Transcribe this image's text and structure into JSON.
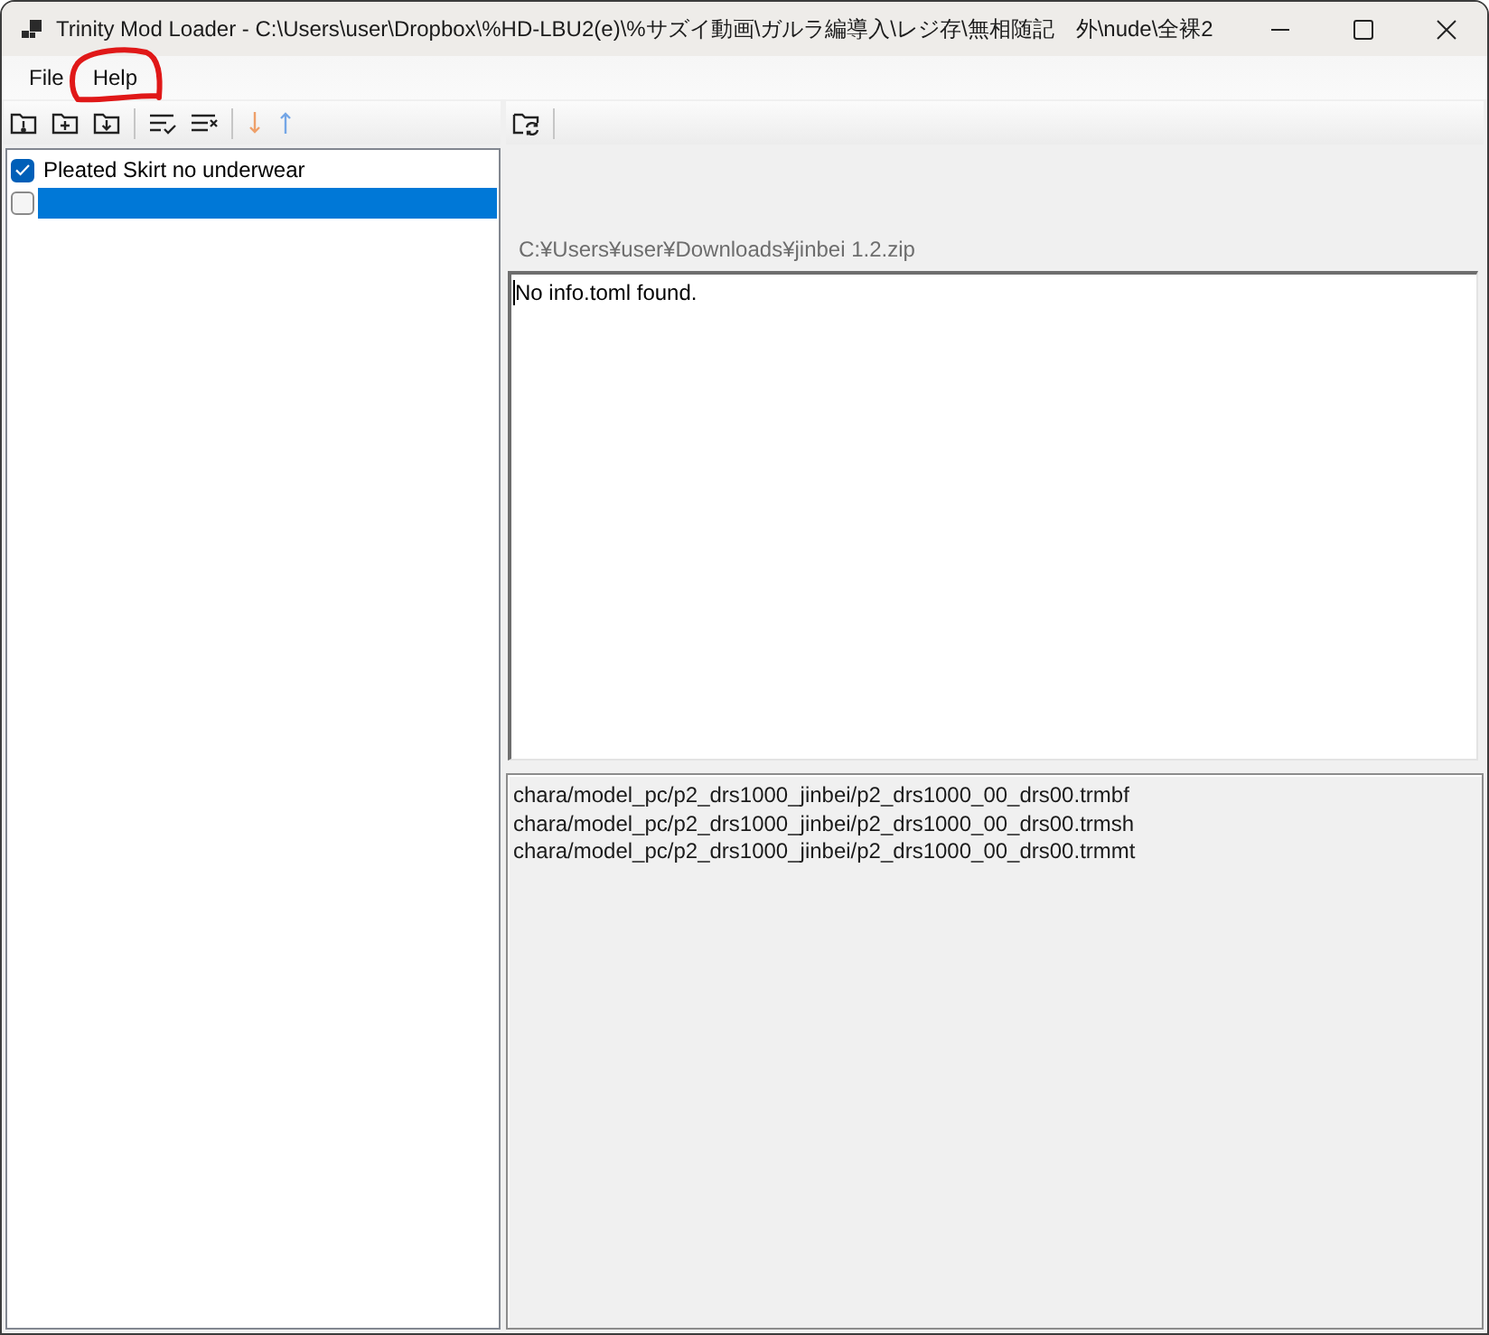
{
  "window": {
    "title": "Trinity Mod Loader - C:\\Users\\user\\Dropbox\\%HD-LBU2(e)\\%サズイ動画\\ガルラ編導入\\レジ存\\無相随記　外\\nude\\全裸2"
  },
  "menu": [
    {
      "label": "File"
    },
    {
      "label": "Help"
    }
  ],
  "mod_list": {
    "items": [
      {
        "label": "Pleated Skirt no underwear",
        "checked": true,
        "selected": false
      },
      {
        "checked": false,
        "selected": true
      }
    ]
  },
  "details": {
    "path": "C:¥Users¥user¥Downloads¥jinbei 1.2.zip",
    "info": "No info.toml found.",
    "files": [
      "chara/model_pc/p2_drs1000_jinbei/p2_drs1000_00_drs00.trmbf",
      "chara/model_pc/p2_drs1000_jinbei/p2_drs1000_00_drs00.trmsh",
      "chara/model_pc/p2_drs1000_jinbei/p2_drs1000_00_drs00.trmmt"
    ]
  }
}
